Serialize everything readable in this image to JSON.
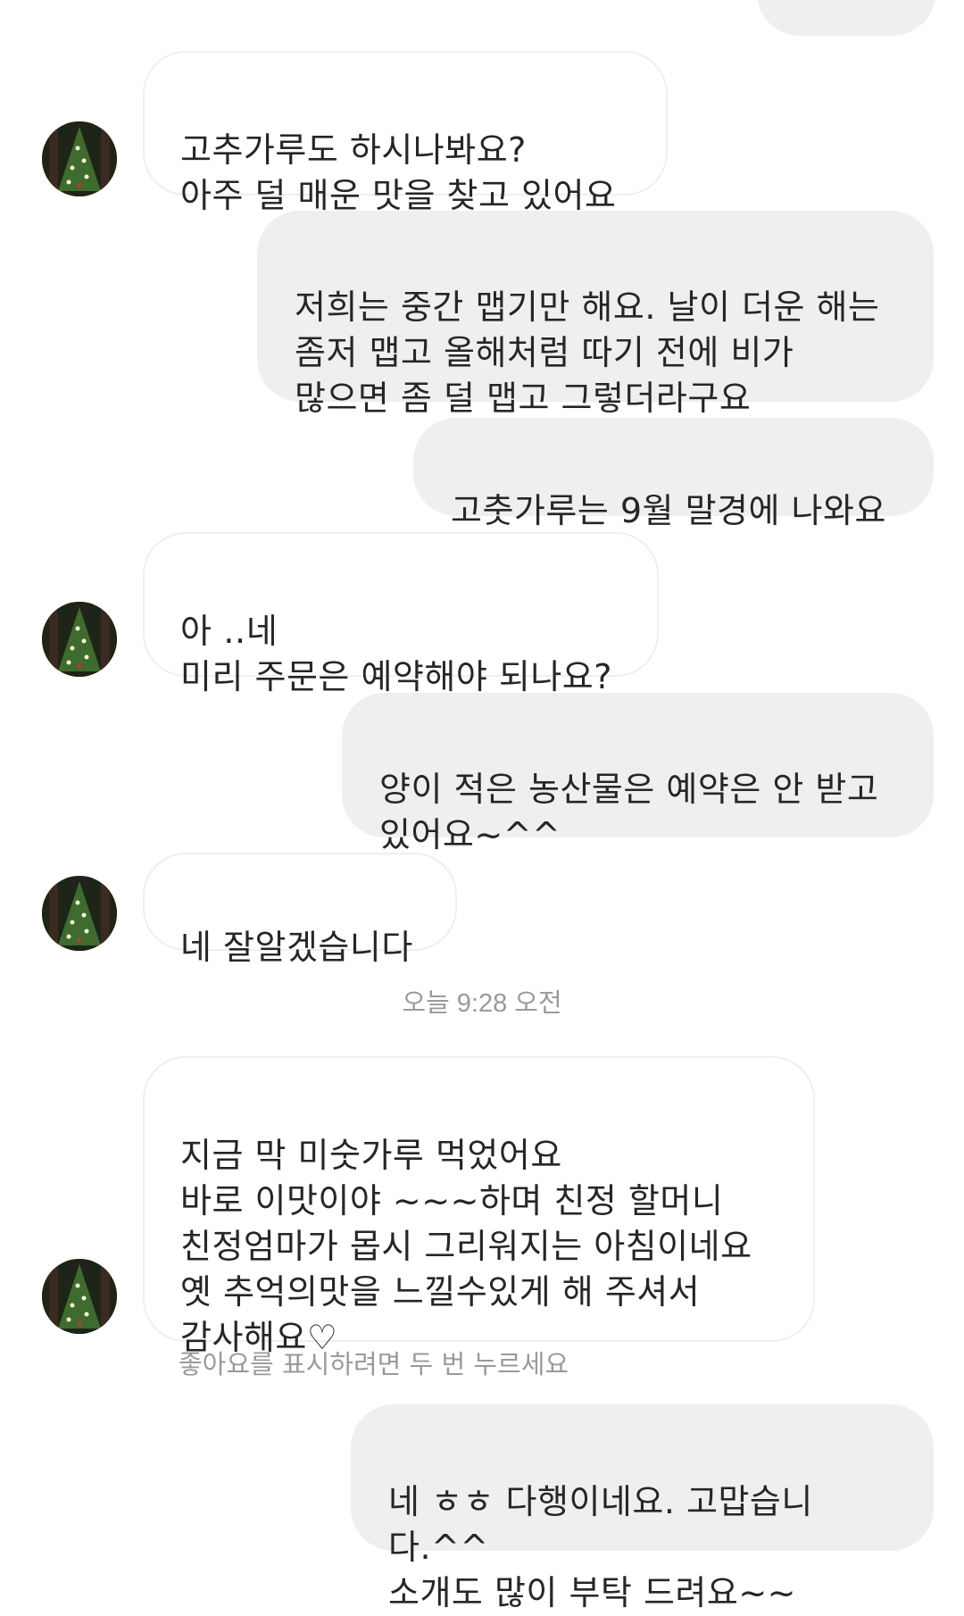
{
  "thread": {
    "messages": [
      {
        "id": "m0",
        "from": "me",
        "text": ""
      },
      {
        "id": "m1",
        "from": "them",
        "text": "고추가루도 하시나봐요?\n아주 덜 매운  맛을 찾고 있어요"
      },
      {
        "id": "m2",
        "from": "me",
        "text": "저희는 중간 맵기만 해요. 날이 더운 해는\n좀저 맵고 올해처럼 따기 전에 비가\n많으면 좀 덜 맵고 그렇더라구요"
      },
      {
        "id": "m3",
        "from": "me",
        "text": "고춧가루는 9월 말경에 나와요"
      },
      {
        "id": "m4",
        "from": "them",
        "text": "아 ‥네\n미리 주문은 예약해야 되나요?"
      },
      {
        "id": "m5",
        "from": "me",
        "text": "양이 적은 농산물은 예약은 안 받고\n있어요~^^"
      },
      {
        "id": "m6",
        "from": "them",
        "text": "네 잘알겠습니다"
      },
      {
        "id": "m7",
        "from": "them",
        "text": "지금 막 미숫가루  먹었어요\n바로 이맛이야 ~~~하며 친정 할머니\n친정엄마가 몹시 그리워지는 아침이네요\n옛 추억의맛을 느낄수있게 해 주셔서\n감사해요♡"
      },
      {
        "id": "m8",
        "from": "me",
        "text": "네 ㅎㅎ 다행이네요. 고맙습니다.^^\n소개도 많이 부탁 드려요~~"
      }
    ],
    "timestamp": "오늘 9:28 오전",
    "double_tap_hint": "좋아요를 표시하려면 두 번 누르세요"
  },
  "avatar": {
    "icon": "christmas-tree-avatar-icon",
    "background_color": "#1d2418",
    "tree_color": "#3f6b2e"
  },
  "colors": {
    "incoming_bubble_bg": "#ffffff",
    "incoming_bubble_border": "#efefef",
    "outgoing_bubble_bg": "#efefef",
    "text": "#262626",
    "meta_text": "#9a9a9a"
  }
}
